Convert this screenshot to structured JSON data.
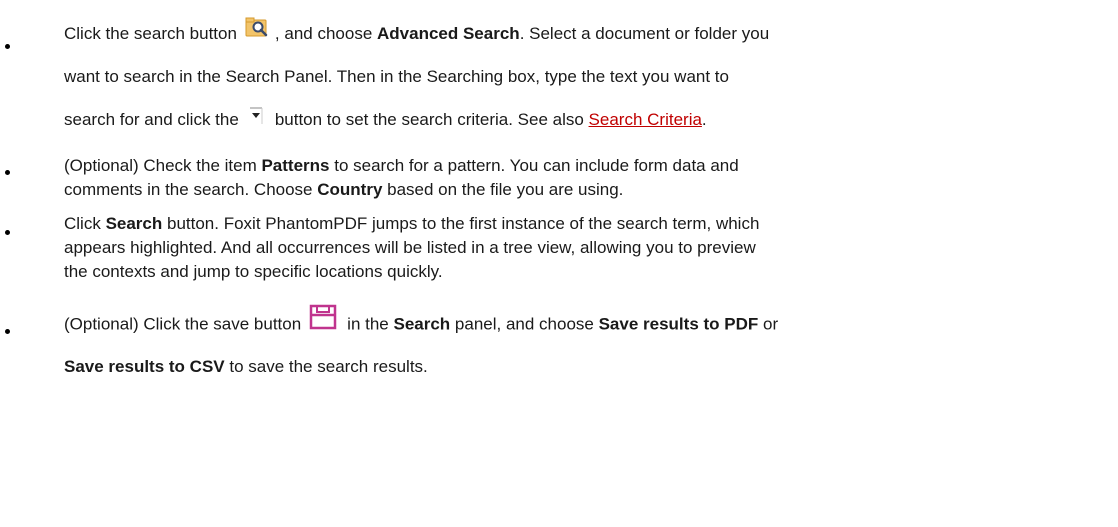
{
  "bullets": [
    {
      "lines": [
        {
          "p1": "Click the search button",
          "p2": ", and choose ",
          "b1": "Advanced Search",
          "p3": ". Select a document or folder you"
        },
        {
          "p1": "want to search in the Search Panel. Then in the Searching box, type the text you want to"
        },
        {
          "p1": "search for and click the",
          "p2": "button to set the search criteria. See also ",
          "link": "Search Criteria",
          "p3": "."
        }
      ]
    },
    {
      "lines": [
        {
          "p1": "(Optional) Check the item ",
          "b1": "Patterns",
          "p2": " to search for a pattern. You can include form data and"
        },
        {
          "p1": "comments in the search. Choose ",
          "b1": "Country",
          "p2": " based on the file you are using."
        }
      ]
    },
    {
      "lines": [
        {
          "p1": "Click ",
          "b1": "Search",
          "p2": " button. Foxit PhantomPDF jumps to the first instance of the search term, which"
        },
        {
          "p1": "appears highlighted. And all occurrences will be listed in a tree view, allowing you to preview"
        },
        {
          "p1": "the contexts and jump to specific locations quickly."
        }
      ]
    },
    {
      "lines": [
        {
          "p1": "(Optional) Click the save button",
          "p2": "in the ",
          "b1": "Search",
          "p3": " panel, and choose ",
          "b2": "Save results to PDF",
          "p4": " or"
        },
        {
          "b1": "Save results to CSV",
          "p1": " to save the search results."
        }
      ]
    }
  ],
  "icons": {
    "search_button": "search-folder-icon",
    "dropdown_button": "dropdown-arrow-icon",
    "save_button": "save-icon"
  },
  "colors": {
    "link": "#c00000",
    "save_icon": "#c0348e",
    "folder_icon": "#e8b04a"
  }
}
